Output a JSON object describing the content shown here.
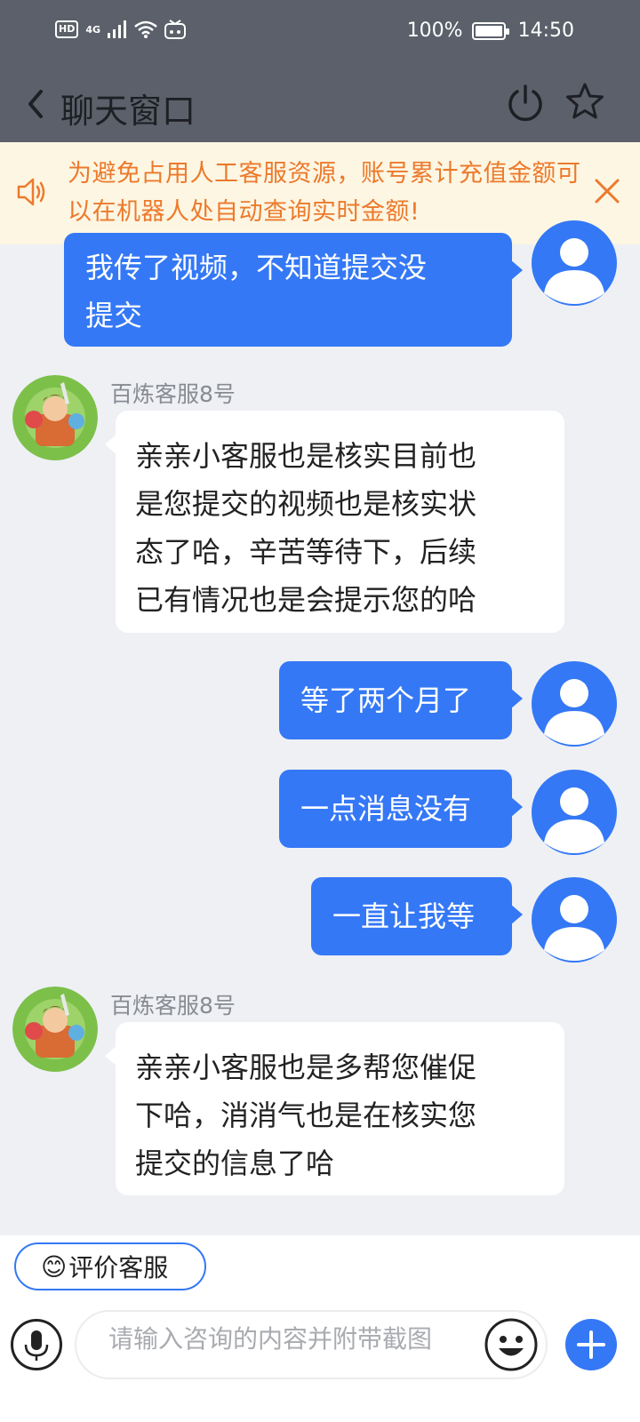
{
  "status_bar": {
    "hd": "HD",
    "network": "4G",
    "battery": "100%",
    "time": "14:50"
  },
  "header": {
    "title": "聊天窗口",
    "icons": [
      "back-icon",
      "power-icon",
      "star-icon"
    ]
  },
  "notice": {
    "text": "为避免占用人工客服资源，账号累计充值金额可以在机器人处自动查询实时金额!",
    "icons": [
      "speaker-icon",
      "close-icon"
    ]
  },
  "messages": [
    {
      "from": "user",
      "text_line1": "我传了视频，不知道提交没",
      "text_line2": "提交"
    },
    {
      "from": "agent",
      "name": "百炼客服8号",
      "lines": [
        "亲亲小客服也是核实目前也",
        "是您提交的视频也是核实状",
        "态了哈，辛苦等待下，后续",
        "已有情况也是会提示您的哈"
      ]
    },
    {
      "from": "user",
      "text": "等了两个月了"
    },
    {
      "from": "user",
      "text": "一点消息没有"
    },
    {
      "from": "user",
      "text": "一直让我等"
    },
    {
      "from": "agent",
      "name": "百炼客服8号",
      "lines": [
        "亲亲小客服也是多帮您催促",
        "下哈，消消气也是在核实您",
        "提交的信息了哈"
      ]
    }
  ],
  "bottom": {
    "rate_label": "评价客服",
    "rate_emoji": "😊",
    "input_placeholder": "请输入咨询的内容并附带截图",
    "icons": [
      "mic-icon",
      "emoji-icon",
      "plus-icon"
    ]
  },
  "colors": {
    "header_bg": "#5b606a",
    "accent_blue": "#3478f6",
    "notice_bg": "#fdf6e3",
    "notice_text": "#ec7a2c",
    "chat_bg": "#eef0f4"
  }
}
